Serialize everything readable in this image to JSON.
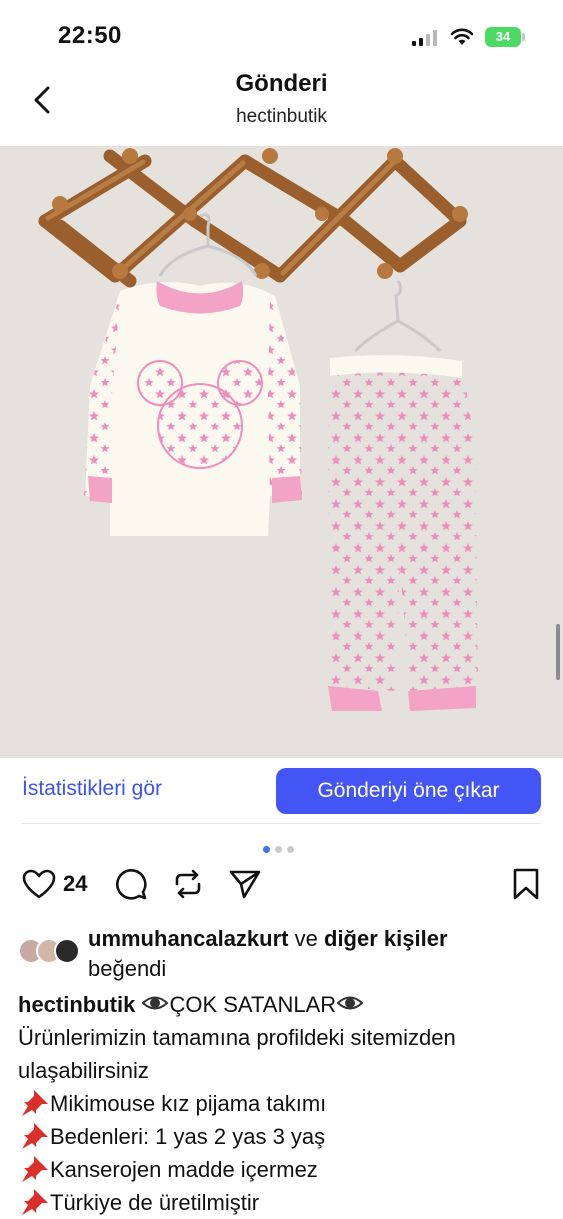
{
  "status_bar": {
    "time": "22:50",
    "battery": "34"
  },
  "nav": {
    "title": "Gönderi",
    "subtitle": "hectinbutik",
    "back_icon": "chevron-left-icon"
  },
  "post_image": {
    "description_icon": "product-photo-pajama-set"
  },
  "actions": {
    "stats_label": "İstatistikleri gör",
    "promote_label": "Gönderiyi öne çıkar"
  },
  "carousel": {
    "total": 3,
    "active": 1
  },
  "engagement": {
    "like_count": "24"
  },
  "likes": {
    "user": "ummuhancalazkurt",
    "connector": "ve",
    "others": "diğer kişiler",
    "suffix": "beğendi"
  },
  "caption": {
    "username": "hectinbutik",
    "headline": "ÇOK SATANLAR",
    "line1": "Ürünlerimizin tamamına profildeki sitemizden",
    "line2": "ulaşabilirsiniz",
    "bullets": [
      "Mikimouse kız  pijama takımı",
      "Bedenleri: 1 yas 2 yas 3 yaş",
      "Kanserojen madde içermez",
      "Türkiye de üretilmiştir"
    ]
  },
  "colors": {
    "accent": "#4356f5",
    "link": "#3b53f5",
    "pink": "#f2a3c6",
    "battery": "#4cd964"
  }
}
